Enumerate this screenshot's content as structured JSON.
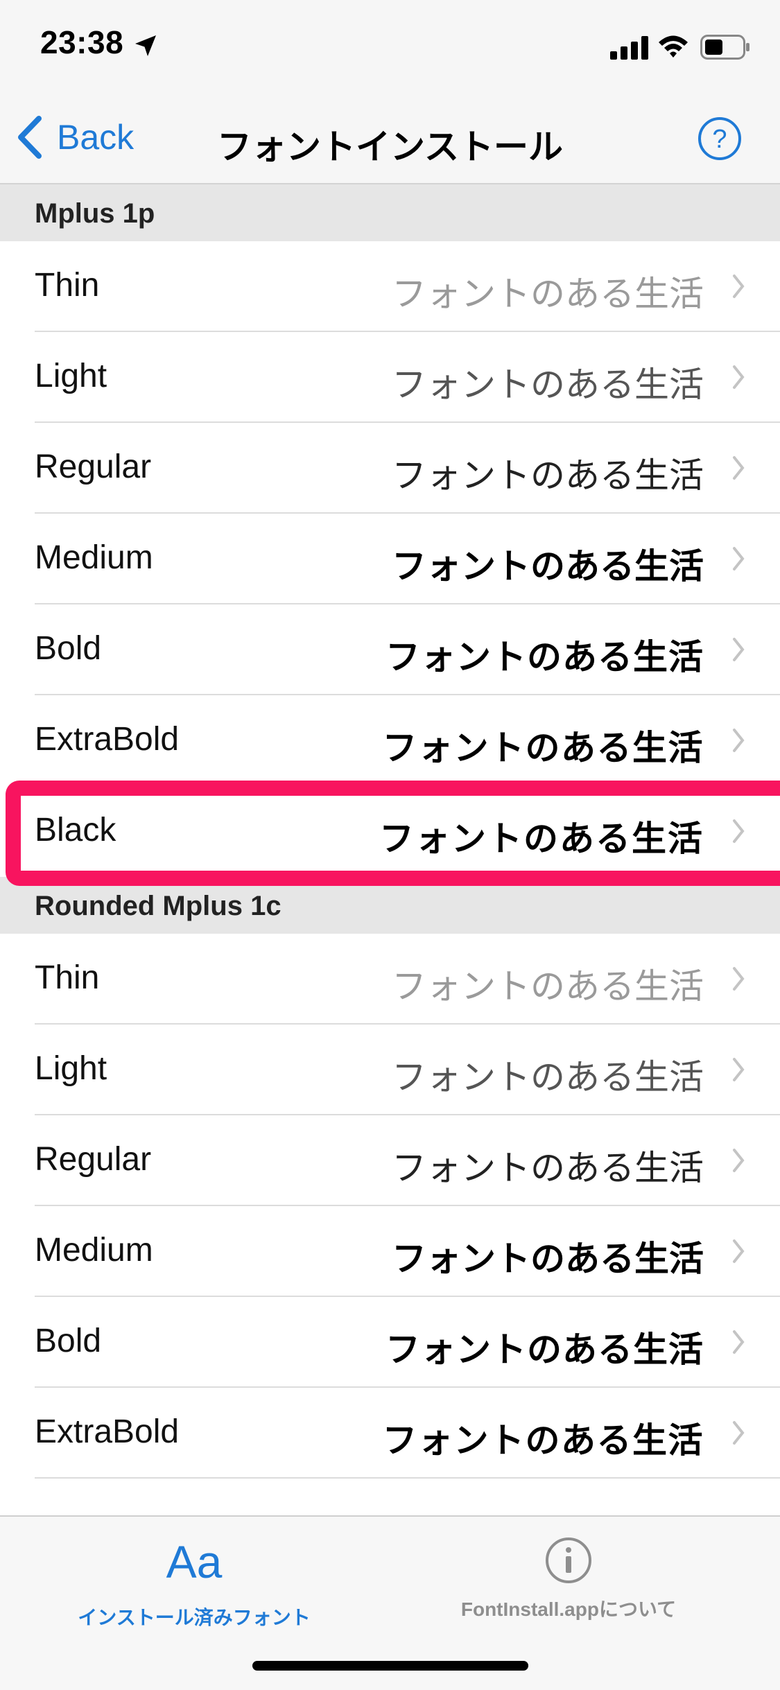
{
  "status_bar": {
    "time": "23:38",
    "icons": [
      "location-arrow-icon",
      "cellular-signal-icon",
      "wifi-icon",
      "battery-icon"
    ]
  },
  "nav": {
    "back_label": "Back",
    "title": "フォントインストール",
    "help_icon": "question-circle-icon"
  },
  "sections": [
    {
      "title": "Mplus 1p",
      "rows": [
        {
          "label": "Thin",
          "sample": "フォントのある生活"
        },
        {
          "label": "Light",
          "sample": "フォントのある生活"
        },
        {
          "label": "Regular",
          "sample": "フォントのある生活"
        },
        {
          "label": "Medium",
          "sample": "フォントのある生活"
        },
        {
          "label": "Bold",
          "sample": "フォントのある生活"
        },
        {
          "label": "ExtraBold",
          "sample": "フォントのある生活"
        },
        {
          "label": "Black",
          "sample": "フォントのある生活"
        }
      ]
    },
    {
      "title": "Rounded Mplus 1c",
      "rows": [
        {
          "label": "Thin",
          "sample": "フォントのある生活"
        },
        {
          "label": "Light",
          "sample": "フォントのある生活"
        },
        {
          "label": "Regular",
          "sample": "フォントのある生活"
        },
        {
          "label": "Medium",
          "sample": "フォントのある生活"
        },
        {
          "label": "Bold",
          "sample": "フォントのある生活"
        },
        {
          "label": "ExtraBold",
          "sample": "フォントのある生活"
        }
      ]
    }
  ],
  "tab_bar": {
    "tabs": [
      {
        "glyph": "Aa",
        "label": "インストール済みフォント",
        "selected": true
      },
      {
        "icon": "info-circle-icon",
        "label": "FontInstall.appについて",
        "selected": false
      }
    ]
  },
  "colors": {
    "accent": "#1f7ad6",
    "highlight": "#f8145f",
    "section_bg": "#e6e6e6"
  }
}
